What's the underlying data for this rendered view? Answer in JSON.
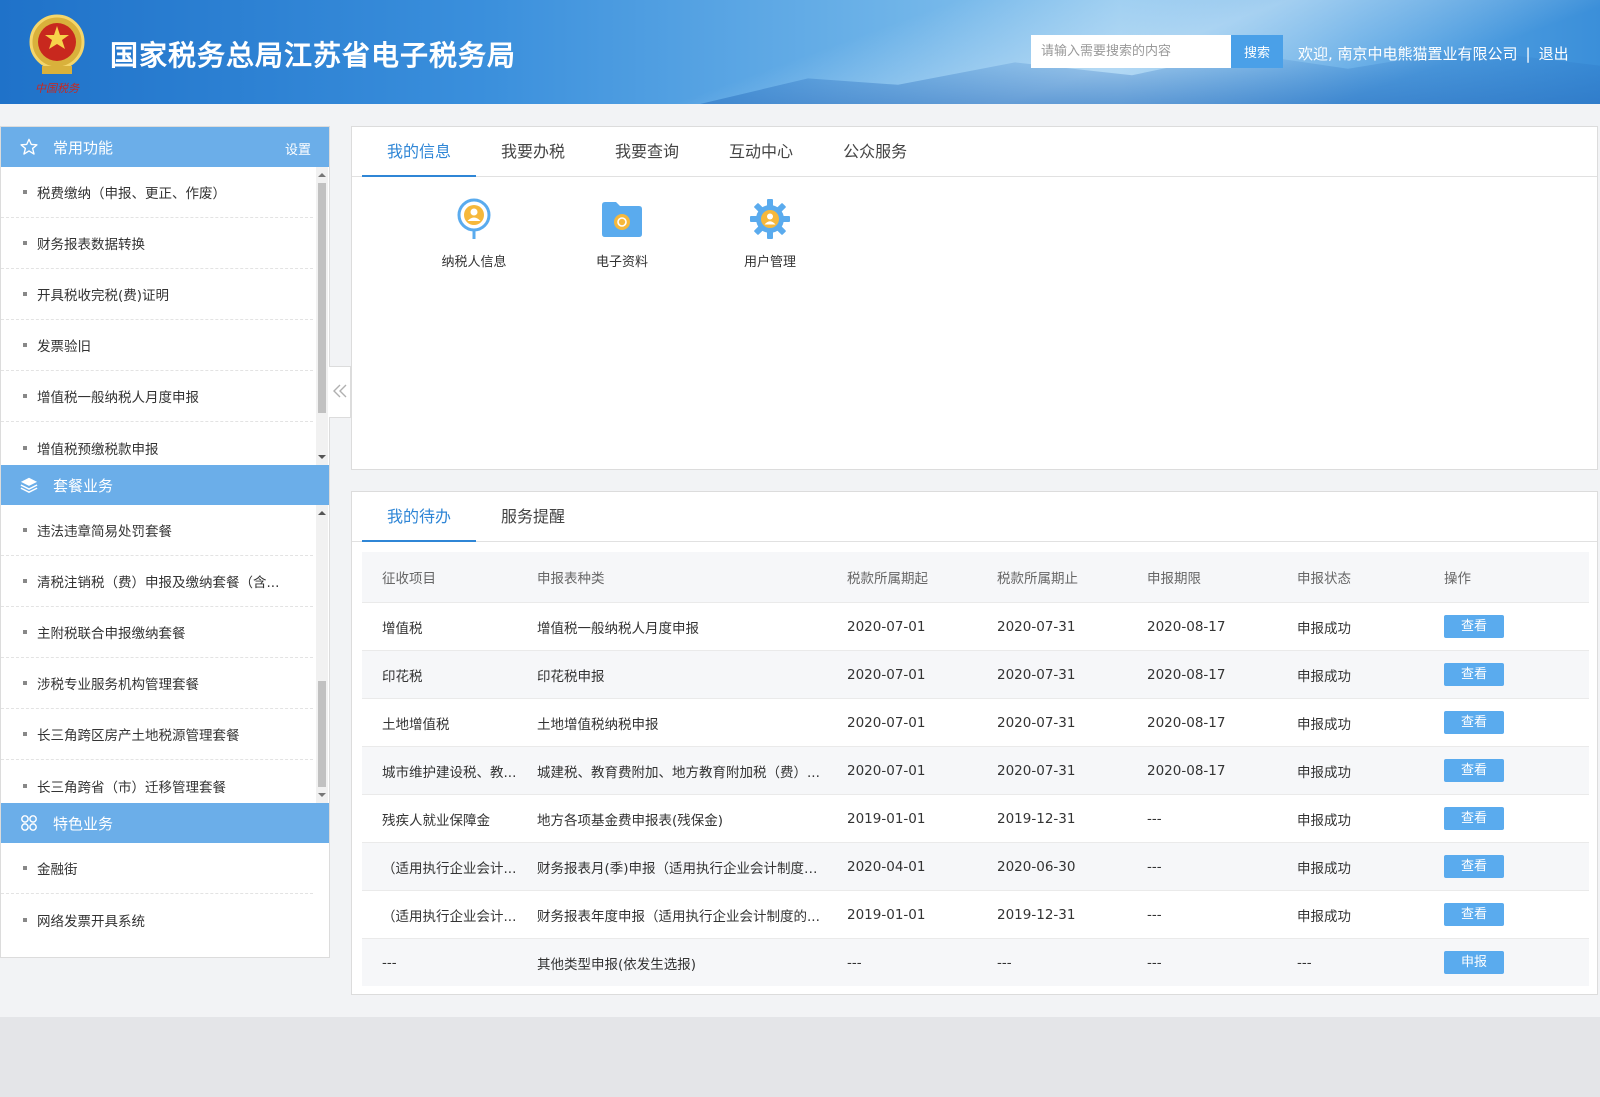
{
  "header": {
    "title": "国家税务总局江苏省电子税务局",
    "emblem_text": "中国税务",
    "search_placeholder": "请输入需要搜索的内容",
    "search_button": "搜索",
    "welcome": "欢迎, 南京中电熊猫置业有限公司",
    "separator": "|",
    "logout": "退出"
  },
  "sidebar": {
    "sections": [
      {
        "title": "常用功能",
        "icon": "star-icon",
        "setting": "设置",
        "items": [
          "税费缴纳（申报、更正、作废）",
          "财务报表数据转换",
          "开具税收完税(费)证明",
          "发票验旧",
          "增值税一般纳税人月度申报",
          "增值税预缴税款申报"
        ]
      },
      {
        "title": "套餐业务",
        "icon": "layers-icon",
        "items": [
          "违法违章简易处罚套餐",
          "清税注销税（费）申报及缴纳套餐（含...",
          "主附税联合申报缴纳套餐",
          "涉税专业服务机构管理套餐",
          "长三角跨区房产土地税源管理套餐",
          "长三角跨省（市）迁移管理套餐"
        ]
      },
      {
        "title": "特色业务",
        "icon": "grid-icon",
        "items": [
          "金融街",
          "网络发票开具系统"
        ]
      }
    ]
  },
  "info_panel": {
    "tabs": [
      "我的信息",
      "我要办税",
      "我要查询",
      "互动中心",
      "公众服务"
    ],
    "active_tab": 0,
    "apps": [
      {
        "label": "纳税人信息",
        "icon": "taxpayer-info-icon"
      },
      {
        "label": "电子资料",
        "icon": "folder-icon"
      },
      {
        "label": "用户管理",
        "icon": "gear-user-icon"
      }
    ]
  },
  "todo_panel": {
    "tabs": [
      "我的待办",
      "服务提醒"
    ],
    "active_tab": 0,
    "columns": [
      "征收项目",
      "申报表种类",
      "税款所属期起",
      "税款所属期止",
      "申报期限",
      "申报状态",
      "操作"
    ],
    "rows": [
      [
        "增值税",
        "增值税一般纳税人月度申报",
        "2020-07-01",
        "2020-07-31",
        "2020-08-17",
        "申报成功",
        "查看"
      ],
      [
        "印花税",
        "印花税申报",
        "2020-07-01",
        "2020-07-31",
        "2020-08-17",
        "申报成功",
        "查看"
      ],
      [
        "土地增值税",
        "土地增值税纳税申报",
        "2020-07-01",
        "2020-07-31",
        "2020-08-17",
        "申报成功",
        "查看"
      ],
      [
        "城市维护建设税、教...",
        "城建税、教育费附加、地方教育附加税（费）...",
        "2020-07-01",
        "2020-07-31",
        "2020-08-17",
        "申报成功",
        "查看"
      ],
      [
        "残疾人就业保障金",
        "地方各项基金费申报表(残保金)",
        "2019-01-01",
        "2019-12-31",
        "---",
        "申报成功",
        "查看"
      ],
      [
        "（适用执行企业会计...",
        "财务报表月(季)申报（适用执行企业会计制度的...",
        "2020-04-01",
        "2020-06-30",
        "---",
        "申报成功",
        "查看"
      ],
      [
        "（适用执行企业会计...",
        "财务报表年度申报（适用执行企业会计制度的...",
        "2019-01-01",
        "2019-12-31",
        "---",
        "申报成功",
        "查看"
      ],
      [
        "---",
        "其他类型申报(依发生选报)",
        "---",
        "---",
        "---",
        "---",
        "申报"
      ]
    ]
  },
  "colors": {
    "accent": "#2f86d6",
    "sidebar_header": "#6baee9",
    "button": "#5aabee"
  }
}
